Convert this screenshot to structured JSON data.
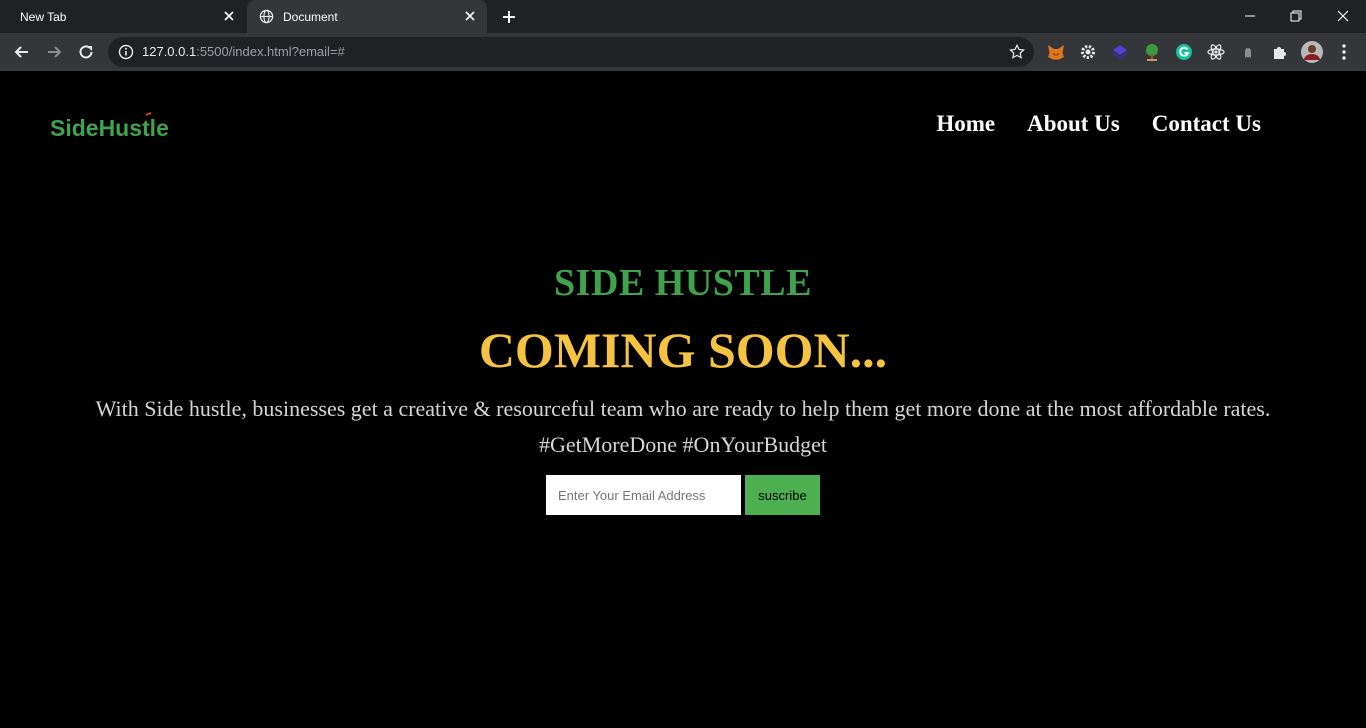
{
  "browser": {
    "tabs": [
      {
        "title": "New Tab"
      },
      {
        "title": "Document"
      }
    ],
    "url": {
      "host": "127.0.0.1",
      "path": ":5500/index.html?email=#"
    }
  },
  "header": {
    "logo": {
      "text": "SideHustle"
    },
    "nav": [
      "Home",
      "About Us",
      "Contact Us"
    ]
  },
  "hero": {
    "title": "SIDE HUSTLE",
    "subtitle": "COMING SOON...",
    "description_line1": "With Side hustle, businesses get a creative & resourceful team who are ready to help them get more done at the most affordable rates.",
    "description_line2": "#GetMoreDone #OnYourBudget"
  },
  "signup": {
    "email_placeholder": "Enter Your Email Address",
    "email_value": "",
    "button_label": "suscribe"
  },
  "colors": {
    "accent_green": "#3fa34d",
    "accent_yellow": "#f5c242",
    "button_green": "#4caf50",
    "background": "#000000"
  }
}
